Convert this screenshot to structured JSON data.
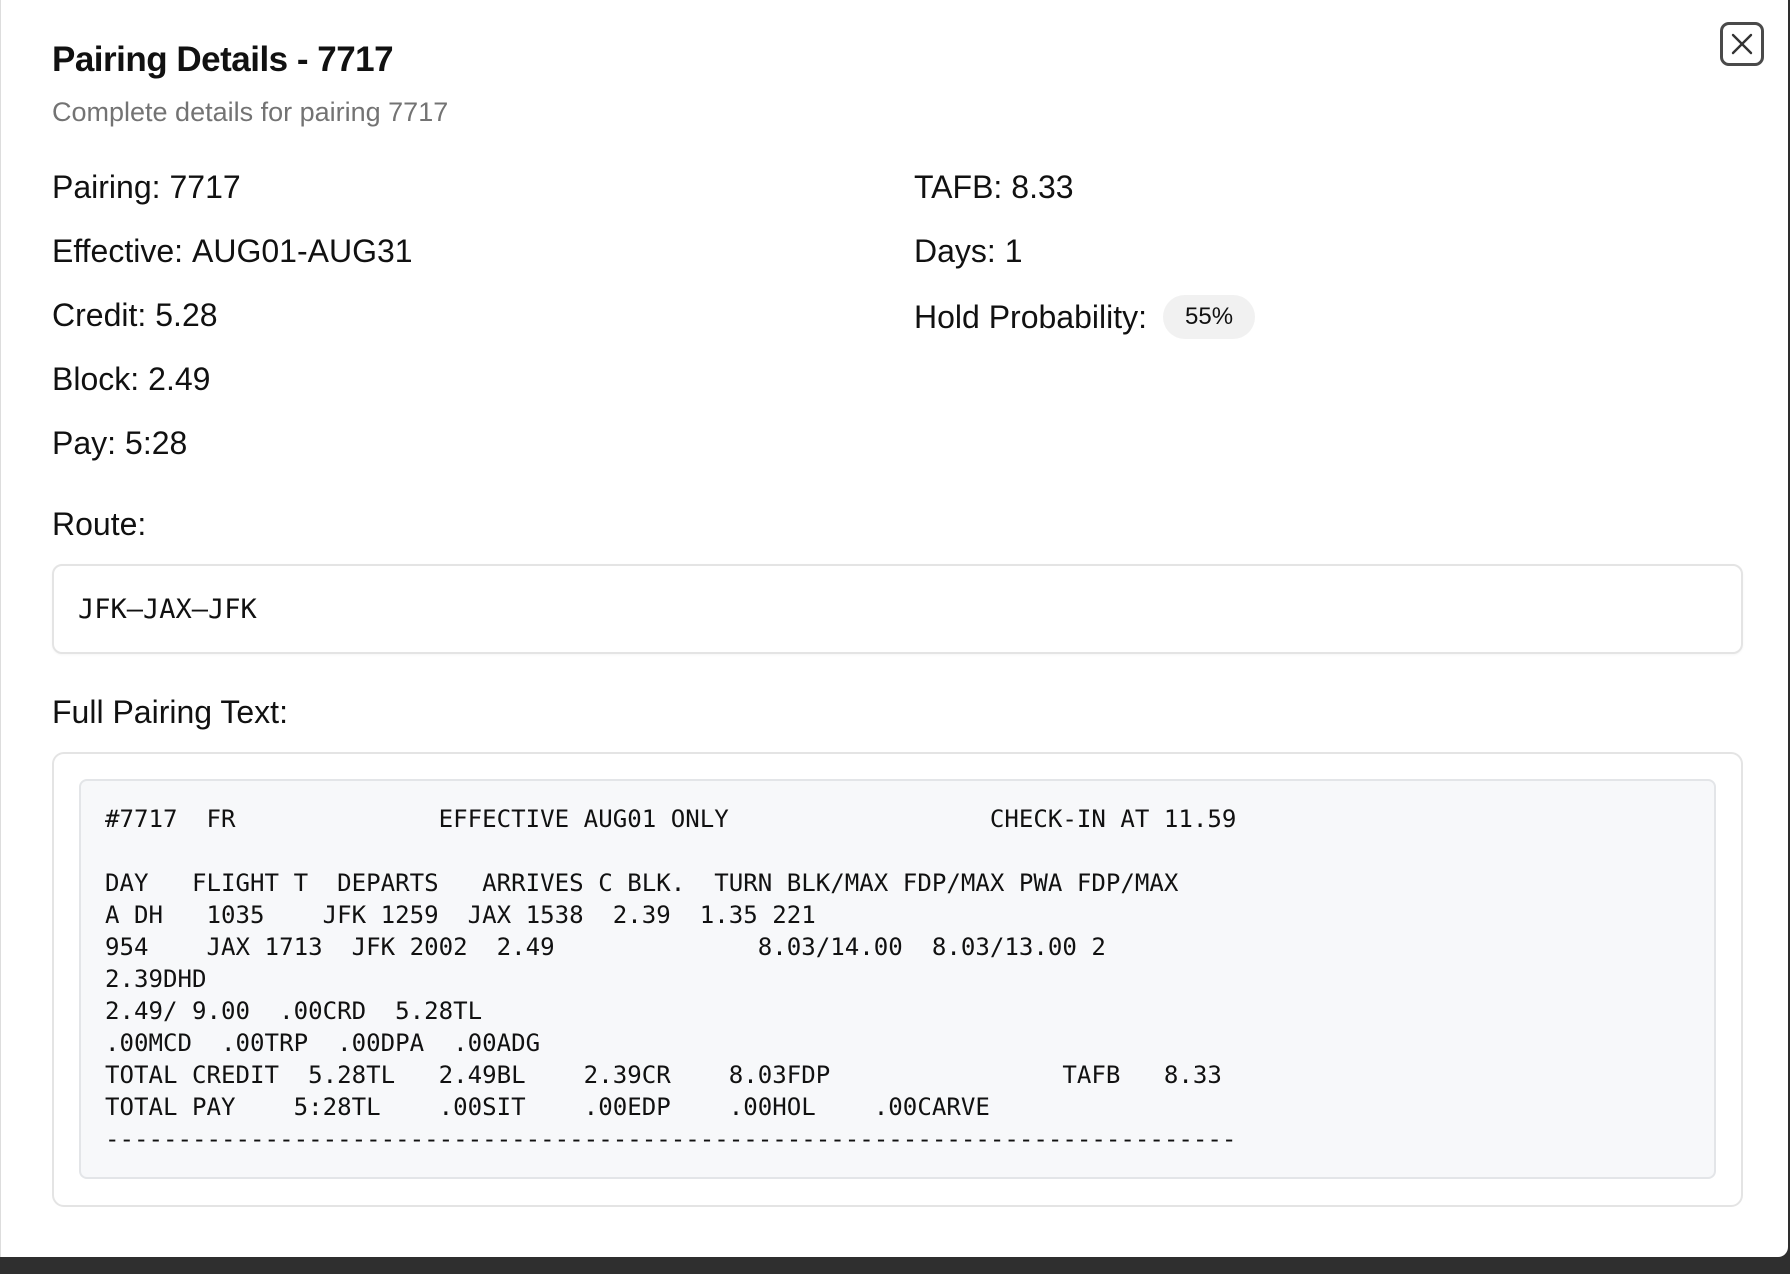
{
  "dialog": {
    "title": "Pairing Details - 7717",
    "subtitle": "Complete details for pairing 7717",
    "close_icon": "close-icon"
  },
  "details": {
    "pairing": {
      "label": "Pairing:",
      "value": "7717"
    },
    "effective": {
      "label": "Effective:",
      "value": "AUG01-AUG31"
    },
    "credit": {
      "label": "Credit:",
      "value": "5.28"
    },
    "block": {
      "label": "Block:",
      "value": "2.49"
    },
    "pay": {
      "label": "Pay:",
      "value": "5:28"
    },
    "tafb": {
      "label": "TAFB:",
      "value": "8.33"
    },
    "days": {
      "label": "Days:",
      "value": "1"
    },
    "hold_probability": {
      "label": "Hold Probability:",
      "value": "55%"
    }
  },
  "route": {
    "label": "Route:",
    "value": "JFK–JAX–JFK"
  },
  "full_text": {
    "label": "Full Pairing Text:",
    "lines": [
      "#7717  FR              EFFECTIVE AUG01 ONLY                  CHECK-IN AT 11.59",
      "",
      "DAY   FLIGHT T  DEPARTS   ARRIVES C BLK.  TURN BLK/MAX FDP/MAX PWA FDP/MAX",
      "A DH   1035    JFK 1259  JAX 1538  2.39  1.35 221",
      "954    JAX 1713  JFK 2002  2.49              8.03/14.00  8.03/13.00 2",
      "2.39DHD",
      "2.49/ 9.00  .00CRD  5.28TL",
      ".00MCD  .00TRP  .00DPA  .00ADG",
      "TOTAL CREDIT  5.28TL   2.49BL    2.39CR    8.03FDP                TAFB   8.33",
      "TOTAL PAY    5:28TL    .00SIT    .00EDP    .00HOL    .00CARVE",
      "------------------------------------------------------------------------------"
    ]
  }
}
